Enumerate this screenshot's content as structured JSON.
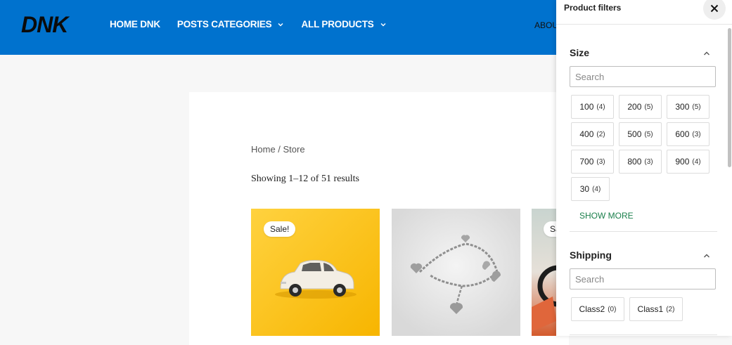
{
  "header": {
    "logo_text": "DNK",
    "nav": [
      {
        "label": "HOME DNK",
        "has_dropdown": false
      },
      {
        "label": "POSTS CATEGORIES",
        "has_dropdown": true
      },
      {
        "label": "ALL PRODUCTS",
        "has_dropdown": true
      }
    ],
    "about_label": "ABOU",
    "bg_color": "#0072ce"
  },
  "main": {
    "breadcrumb": "Home / Store",
    "results_text": "Showing 1–12 of 51 results",
    "products": [
      {
        "image": "toy-car-on-yellow",
        "badge": "Sale!"
      },
      {
        "image": "silver-heart-bracelet",
        "badge": ""
      },
      {
        "image": "sunglasses-partial",
        "badge": "Sa"
      }
    ]
  },
  "filters": {
    "title": "Product filters",
    "close_icon": "close-icon",
    "sections": [
      {
        "title": "Size",
        "search_placeholder": "Search",
        "options": [
          {
            "label": "100",
            "count": "(4)"
          },
          {
            "label": "200",
            "count": "(5)"
          },
          {
            "label": "300",
            "count": "(5)"
          },
          {
            "label": "400",
            "count": "(2)"
          },
          {
            "label": "500",
            "count": "(5)"
          },
          {
            "label": "600",
            "count": "(3)"
          },
          {
            "label": "700",
            "count": "(3)"
          },
          {
            "label": "800",
            "count": "(3)"
          },
          {
            "label": "900",
            "count": "(4)"
          },
          {
            "label": "30",
            "count": "(4)"
          }
        ],
        "show_more": "SHOW MORE"
      },
      {
        "title": "Shipping",
        "search_placeholder": "Search",
        "options": [
          {
            "label": "Class2",
            "count": "(0)"
          },
          {
            "label": "Class1",
            "count": "(2)"
          }
        ]
      }
    ],
    "accent_color": "#1a7f4b"
  }
}
